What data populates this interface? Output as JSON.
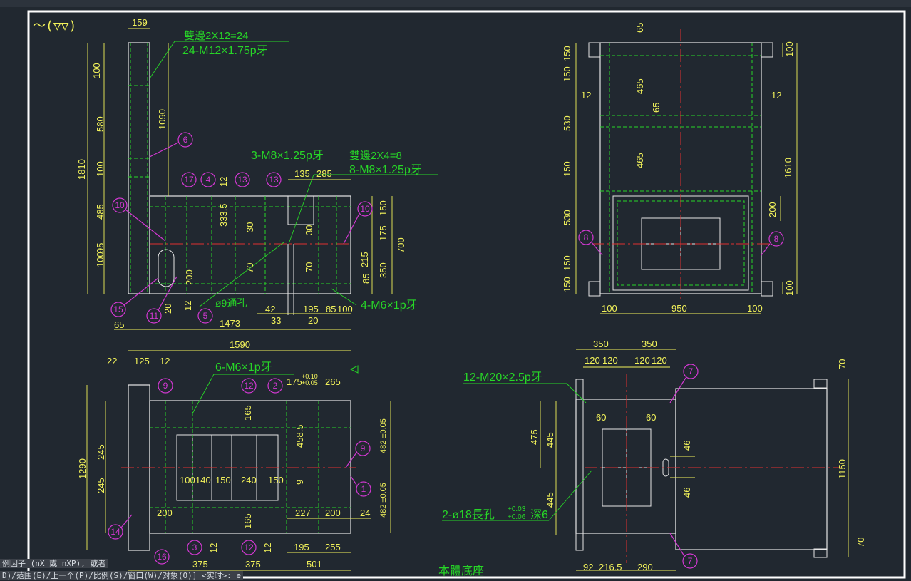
{
  "drawing": {
    "title": "本體底座",
    "finish_symbol": "～(▽▽)",
    "colors": {
      "background": "#212830",
      "dimension": "#f2f25a",
      "outline": "#e6e6e6",
      "hidden": "#27d627",
      "center": "#e03030",
      "balloon": "#d238d2",
      "text": "#27d627"
    },
    "front_view": {
      "notes": [
        "雙邊2X12=24",
        "24-M12×1.75p牙",
        "3-M8×1.25p牙",
        "雙邊2X4=8",
        "8-M8×1.25p牙",
        "4-M6×1p牙",
        "ø9通孔"
      ],
      "dims": [
        "159",
        "100",
        "580",
        "1090",
        "100",
        "485",
        "1810",
        "100",
        "95",
        "200",
        "20",
        "12",
        "65",
        "1473",
        "12",
        "333.5",
        "30",
        "30",
        "70",
        "70",
        "135",
        "285",
        "150",
        "175",
        "700",
        "215",
        "350",
        "85",
        "42",
        "33",
        "20",
        "195",
        "85",
        "100"
      ],
      "balloons": [
        "6",
        "17",
        "4",
        "13",
        "13",
        "10",
        "10",
        "15",
        "11",
        "5"
      ]
    },
    "side_view": {
      "dims": [
        "65",
        "150",
        "150",
        "12",
        "465",
        "65",
        "530",
        "465",
        "150",
        "530",
        "150",
        "150",
        "12",
        "100",
        "1610",
        "200",
        "100",
        "100",
        "950",
        "100"
      ],
      "balloons": [
        "8",
        "8"
      ]
    },
    "plan_view": {
      "notes": [
        "6-M6×1p牙"
      ],
      "dims": [
        "1590",
        "22",
        "125",
        "12",
        "+0.10",
        "+0.05",
        "175",
        "265",
        "245",
        "245",
        "1290",
        "165",
        "458.5",
        "9",
        "482 ±0.05",
        "482 ±0.05",
        "100",
        "140",
        "150",
        "240",
        "150",
        "200",
        "227",
        "200",
        "24",
        "165",
        "12",
        "12",
        "195",
        "255",
        "375",
        "375",
        "501"
      ],
      "balloons": [
        "9",
        "12",
        "2",
        "9",
        "1",
        "14",
        "3",
        "12",
        "16"
      ]
    },
    "base_view": {
      "notes": [
        "12-M20×2.5p牙",
        "2-ø18長孔",
        "+0.03",
        "+0.06",
        "深6"
      ],
      "dims": [
        "350",
        "350",
        "120",
        "120",
        "120",
        "120",
        "60",
        "60",
        "475",
        "445",
        "445",
        "46",
        "46",
        "70",
        "1150",
        "70",
        "92",
        "216.5",
        "290"
      ],
      "balloons": [
        "7",
        "7"
      ]
    }
  },
  "command_line": {
    "line1": "例因子 (nX 或 nXP), 或者",
    "line2": "D)/范围(E)/上一个(P)/比例(S)/窗口(W)/对象(O)] <实时>: e"
  }
}
